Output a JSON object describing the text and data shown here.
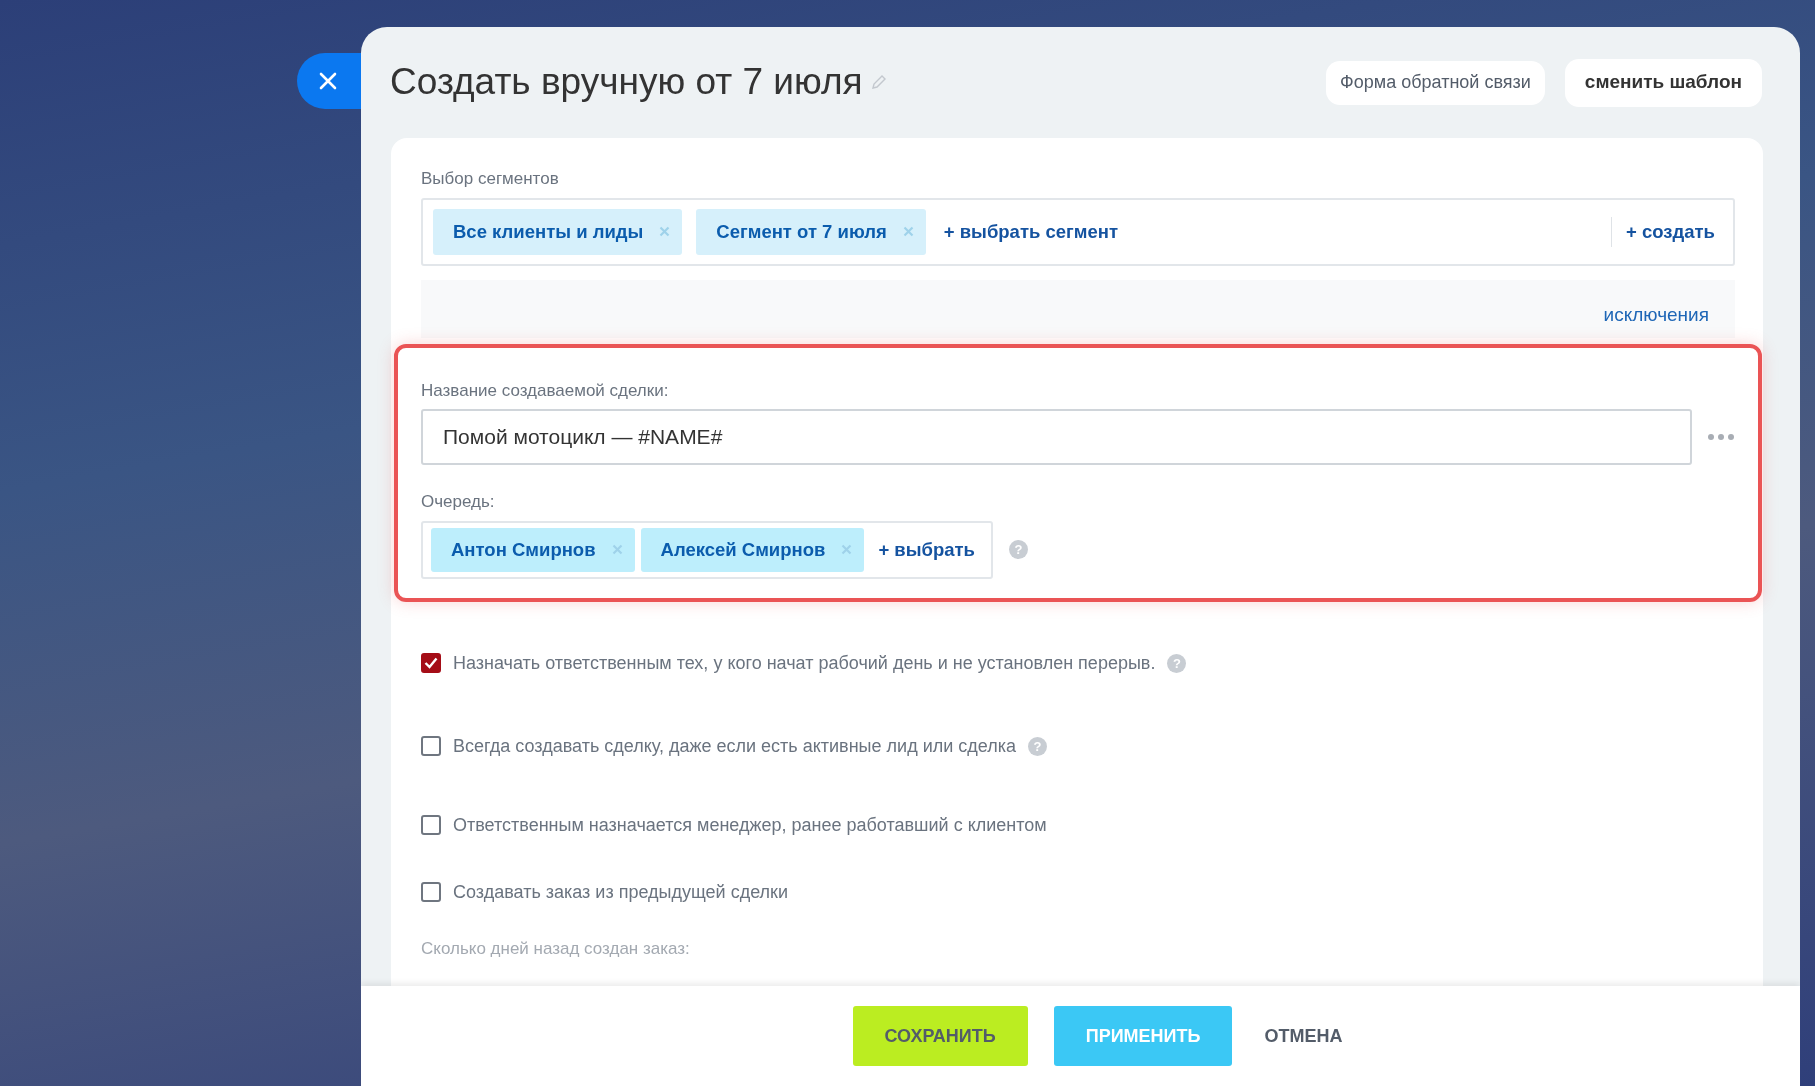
{
  "title": "Создать вручную от 7 июля",
  "header_buttons": [
    {
      "label": "Форма обратной связи",
      "kind": "light"
    },
    {
      "label": "сменить шаблон",
      "kind": "bold"
    }
  ],
  "segments": {
    "label": "Выбор сегментов",
    "tags": [
      "Все клиенты и лиды",
      "Сегмент от 7 июля"
    ],
    "add_link": "+ выбрать сегмент",
    "create_link": "+ создать",
    "exclusions_link": "исключения"
  },
  "deal_name": {
    "label": "Название создаваемой сделки:",
    "value": "Помой мотоцикл — #NAME#"
  },
  "queue": {
    "label": "Очередь:",
    "tags": [
      "Антон Смирнов",
      "Алексей Смирнов"
    ],
    "add_link": "+ выбрать",
    "help": "?"
  },
  "options": [
    {
      "label": "Назначать ответственным тех, у кого начат рабочий день и не установлен перерыв.",
      "checked": true,
      "help": "?"
    },
    {
      "label": "Всегда создавать сделку, даже если есть активные лид или сделка",
      "checked": false,
      "help": "?"
    },
    {
      "label": "Ответственным назначается менеджер, ранее работавший с клиентом",
      "checked": false
    },
    {
      "label": "Создавать заказ из предыдущей сделки",
      "checked": false
    }
  ],
  "partial_label": "Сколько дней назад создан заказ:",
  "footer_buttons": [
    {
      "label": "СОХРАНИТЬ",
      "kind": "save"
    },
    {
      "label": "ПРИМЕНИТЬ",
      "kind": "apply"
    },
    {
      "label": "ОТМЕНА",
      "kind": "cancel"
    }
  ]
}
